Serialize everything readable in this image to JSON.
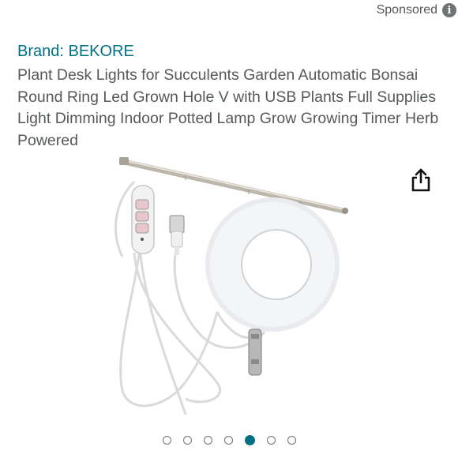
{
  "header": {
    "sponsored_label": "Sponsored",
    "info_icon": "info-icon",
    "info_glyph": "i"
  },
  "product": {
    "brand_link": "Brand: BEKORE",
    "title": "Plant Desk Lights for Succulents Garden Automatic Bonsai Round Ring Led Grown Hole V with USB Plants Full Supplies Light Dimming Indoor Potted Lamp Grow Growing Timer Herb Powered",
    "share_icon": "share-icon"
  },
  "carousel": {
    "total": 7,
    "active_index": 4
  },
  "colors": {
    "link": "#007185",
    "text": "#565959",
    "active_dot": "#007185"
  }
}
